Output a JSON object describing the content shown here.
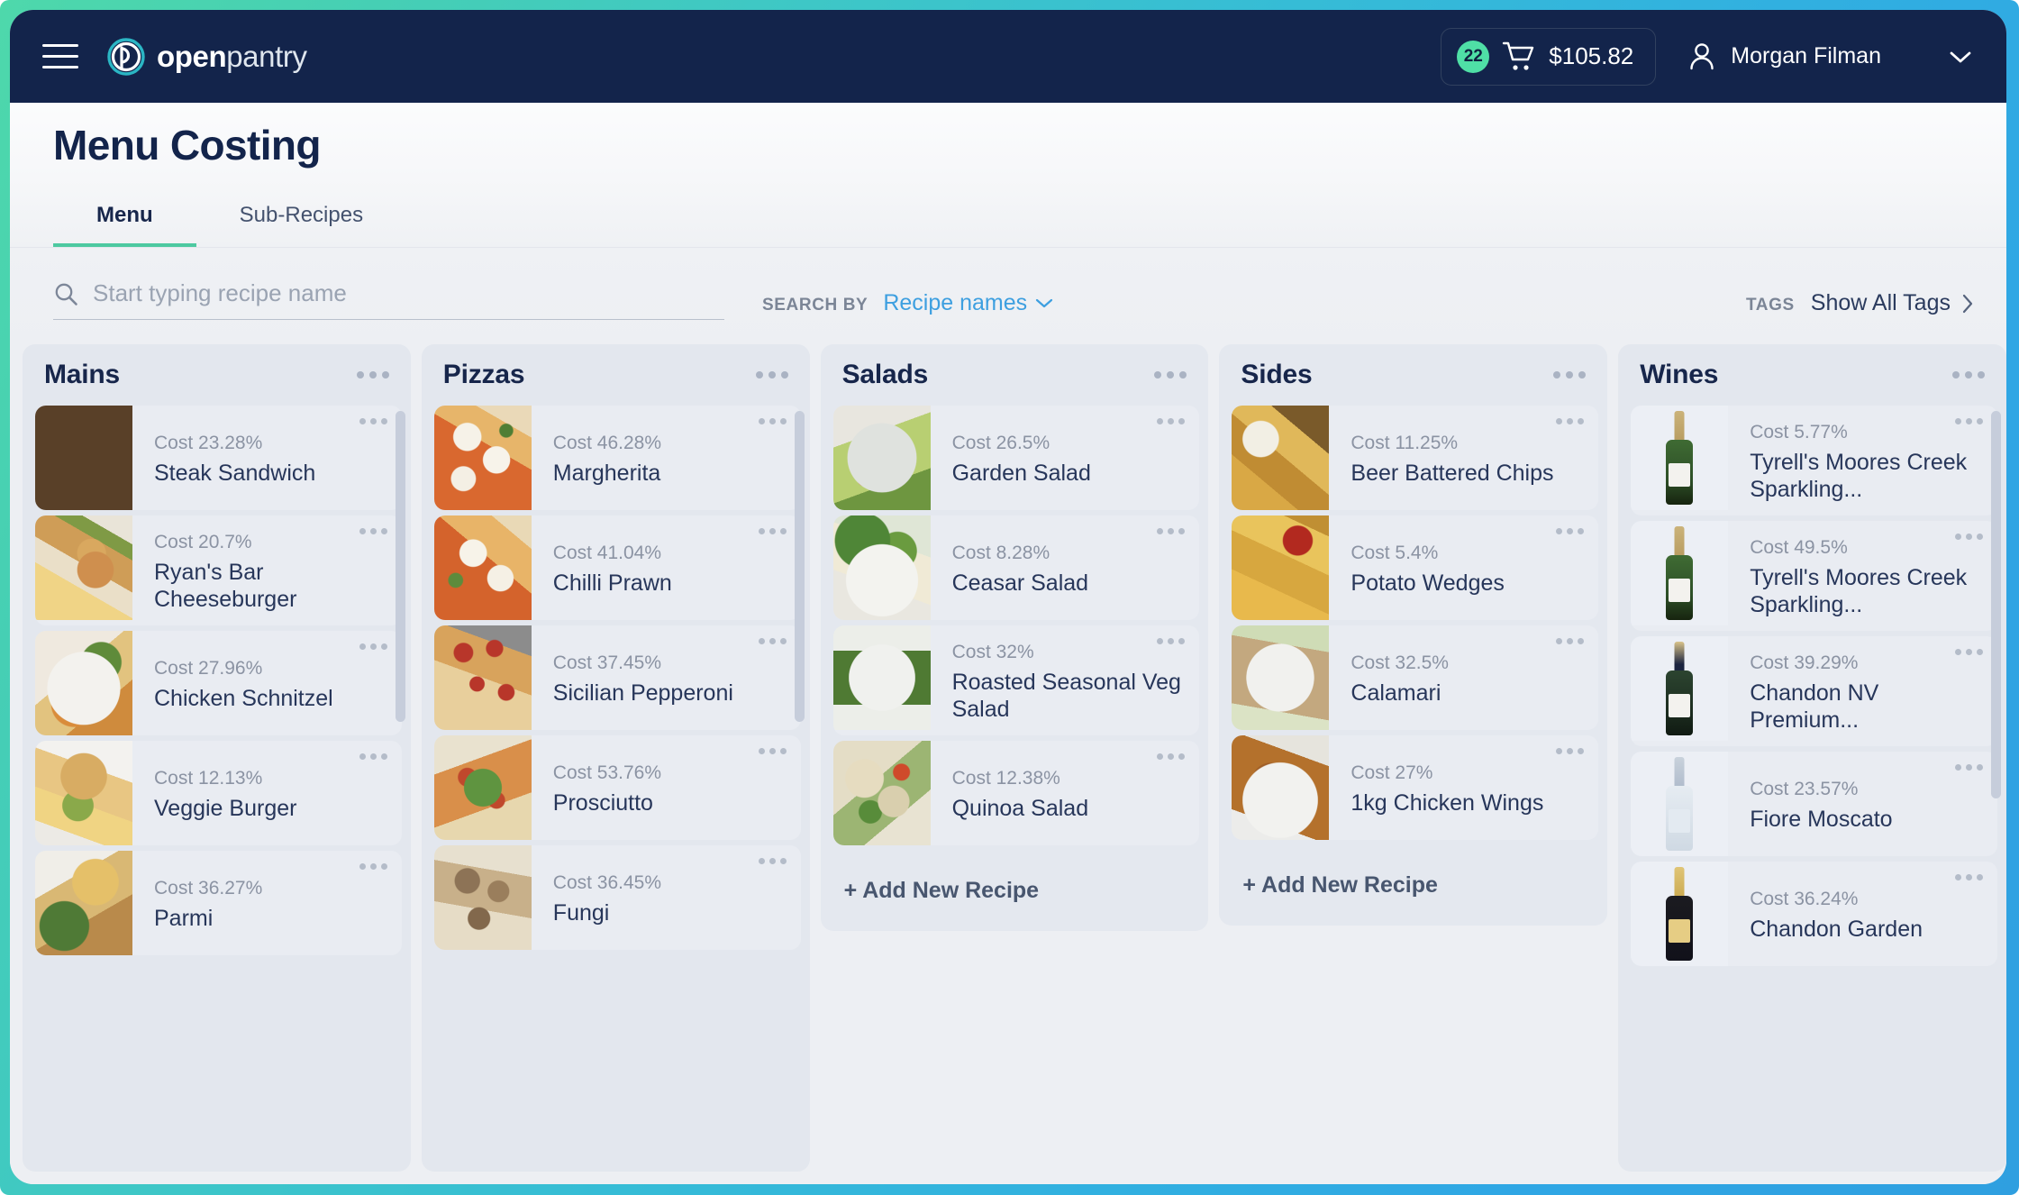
{
  "navbar": {
    "menu_icon": "hamburger-icon",
    "brand_bold": "open",
    "brand_light": "pantry",
    "cart": {
      "badge_count": "22",
      "icon": "shopping-cart-icon",
      "total": "$105.82"
    },
    "user": {
      "icon": "person-icon",
      "name": "Morgan Filman",
      "chevron": "chevron-down-icon"
    }
  },
  "page": {
    "title": "Menu Costing"
  },
  "tabs": [
    {
      "label": "Menu",
      "active": true
    },
    {
      "label": "Sub-Recipes",
      "active": false
    }
  ],
  "search": {
    "icon": "search-icon",
    "placeholder": "Start typing recipe name",
    "value": "",
    "search_by_label": "SEARCH BY",
    "search_by_value": "Recipe names",
    "search_by_chevron": "chevron-down-icon",
    "tags_label": "TAGS",
    "tags_link": "Show All Tags",
    "tags_chevron": "chevron-right-icon"
  },
  "colors": {
    "navbar_bg": "#13244b",
    "badge_green": "#4fdfa6",
    "accent_green": "#4dc9a0",
    "link_blue": "#3d9fe0",
    "frame_gradient_start": "#4ed8ab",
    "frame_gradient_end": "#2f9fe0",
    "column_bg": "#e3e7ee",
    "card_bg": "#e9ecf2",
    "text_dark": "#17264b",
    "text_muted": "#8b93a3"
  },
  "board": {
    "add_recipe_label": "+ Add New Recipe",
    "columns": [
      {
        "title": "Mains",
        "has_scrollbar": true,
        "has_add_button": false,
        "recipes": [
          {
            "cost": "Cost 23.28%",
            "name": "Steak Sandwich",
            "img": "img-steak"
          },
          {
            "cost": "Cost 20.7%",
            "name": "Ryan's Bar Cheeseburger",
            "img": "img-burger1"
          },
          {
            "cost": "Cost 27.96%",
            "name": "Chicken Schnitzel",
            "img": "img-schnitzel"
          },
          {
            "cost": "Cost 12.13%",
            "name": "Veggie Burger",
            "img": "img-veggieburger"
          },
          {
            "cost": "Cost 36.27%",
            "name": "Parmi",
            "img": "img-parmi"
          }
        ]
      },
      {
        "title": "Pizzas",
        "has_scrollbar": true,
        "has_add_button": false,
        "recipes": [
          {
            "cost": "Cost 46.28%",
            "name": "Margherita",
            "img": "img-pizza-marg"
          },
          {
            "cost": "Cost 41.04%",
            "name": "Chilli Prawn",
            "img": "img-pizza-prawn"
          },
          {
            "cost": "Cost 37.45%",
            "name": "Sicilian Pepperoni",
            "img": "img-pizza-pep"
          },
          {
            "cost": "Cost 53.76%",
            "name": "Prosciutto",
            "img": "img-pizza-pros"
          },
          {
            "cost": "Cost 36.45%",
            "name": "Fungi",
            "img": "img-pizza-fungi"
          }
        ]
      },
      {
        "title": "Salads",
        "has_scrollbar": false,
        "has_add_button": true,
        "recipes": [
          {
            "cost": "Cost 26.5%",
            "name": "Garden Salad",
            "img": "img-garden-salad"
          },
          {
            "cost": "Cost 8.28%",
            "name": "Ceasar Salad",
            "img": "img-caesar"
          },
          {
            "cost": "Cost 32%",
            "name": "Roasted Seasonal Veg Salad",
            "img": "img-roasted-salad"
          },
          {
            "cost": "Cost 12.38%",
            "name": "Quinoa Salad",
            "img": "img-quinoa"
          }
        ]
      },
      {
        "title": "Sides",
        "has_scrollbar": false,
        "has_add_button": true,
        "recipes": [
          {
            "cost": "Cost 11.25%",
            "name": "Beer Battered Chips",
            "img": "img-chips"
          },
          {
            "cost": "Cost 5.4%",
            "name": "Potato Wedges",
            "img": "img-wedges"
          },
          {
            "cost": "Cost 32.5%",
            "name": "Calamari",
            "img": "img-calamari"
          },
          {
            "cost": "Cost 27%",
            "name": "1kg Chicken Wings",
            "img": "img-wings"
          }
        ]
      },
      {
        "title": "Wines",
        "has_scrollbar": true,
        "has_add_button": false,
        "recipes": [
          {
            "cost": "Cost 5.77%",
            "name": "Tyrell's Moores Creek Sparkling...",
            "img": "bottle green"
          },
          {
            "cost": "Cost 49.5%",
            "name": "Tyrell's Moores Creek Sparkling...",
            "img": "bottle green"
          },
          {
            "cost": "Cost 39.29%",
            "name": "Chandon NV Premium...",
            "img": "bottle dark"
          },
          {
            "cost": "Cost 23.57%",
            "name": "Fiore Moscato",
            "img": "bottle white"
          },
          {
            "cost": "Cost 36.24%",
            "name": "Chandon Garden",
            "img": "bottle gold"
          }
        ]
      }
    ]
  }
}
